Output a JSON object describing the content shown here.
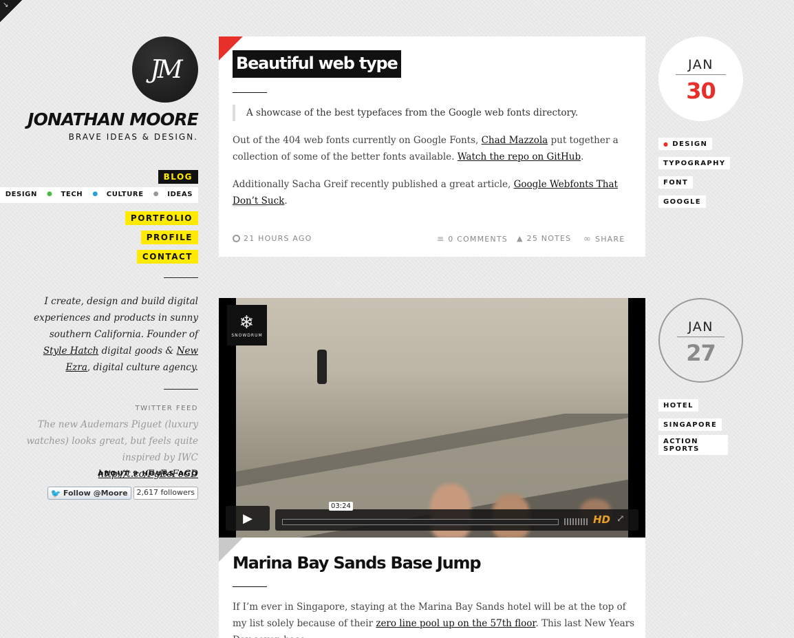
{
  "corner": {
    "icon": "corner-arrow-icon",
    "glyph": "↘"
  },
  "sidebar": {
    "logo_text": "JM",
    "name": "JONATHAN MOORE",
    "tagline": "BRAVE IDEAS & DESIGN.",
    "nav": {
      "blog": "BLOG",
      "portfolio": "PORTFOLIO",
      "profile": "PROFILE",
      "contact": "CONTACT"
    },
    "categories": [
      {
        "label": "DESIGN",
        "dot_color": "#e8302b"
      },
      {
        "label": "TECH",
        "dot_color": "#4cb848"
      },
      {
        "label": "CULTURE",
        "dot_color": "#2a9fd6"
      },
      {
        "label": "IDEAS",
        "dot_color": "#999999"
      }
    ],
    "bio": {
      "text1": "I create, design and build digital experiences and products in sunny southern California. Founder of ",
      "link1": "Style Hatch",
      "text2": " digital goods & ",
      "link2": "New Ezra",
      "text3": ", digital culture agency."
    },
    "twitter": {
      "label": "TWITTER FEED",
      "tweet": "The new Audemars Piguet (luxury watches) looks great, but feels quite inspired by IWC",
      "link": " http://t.co/FgEeFeCD",
      "time": "ABOUT 9 HOURS AGO",
      "follow_label": "Follow @Moore",
      "followers": "2,617 followers"
    }
  },
  "post1": {
    "title": "Beautiful web type",
    "quote": "A showcase of the best typefaces from the Google web fonts directory.",
    "p1_a": "Out of the 404 web fonts currently on Google Fonts, ",
    "p1_link1": "Chad Mazzola",
    "p1_b": " put together a collection of some of the better fonts available.  ",
    "p1_link2": "Watch the repo on GitHub",
    "p1_c": ".",
    "p2_a": "Additionally Sacha Greif recently published a great article, ",
    "p2_link": "Google Webfonts That Don’t Suck",
    "p2_b": ".",
    "time": "21 HOURS AGO",
    "comments": "0 COMMENTS",
    "notes": "25 NOTES",
    "share": "SHARE",
    "date_month": "JAN",
    "date_day": "30",
    "tags": [
      "DESIGN",
      "TYPOGRAPHY",
      "FONT",
      "GOOGLE"
    ]
  },
  "post2": {
    "video_logo": "SNOWDRUM",
    "video_time": "03:24",
    "hd_label": "HD",
    "title": "Marina Bay Sands Base Jump",
    "p1_a": "If I’m ever in Singapore, staying at the Marina Bay Sands hotel will be at the top of my list solely because of their ",
    "p1_link": "zero line pool up on the 57th floor",
    "p1_b": ".  This last New Years Day seven base",
    "date_month": "JAN",
    "date_day": "27",
    "tags": [
      "HOTEL",
      "SINGAPORE",
      "ACTION SPORTS"
    ]
  },
  "colors": {
    "accent_red": "#e8302b",
    "nav_yellow": "#ffea00",
    "date_grey": "#8a8a8a"
  }
}
